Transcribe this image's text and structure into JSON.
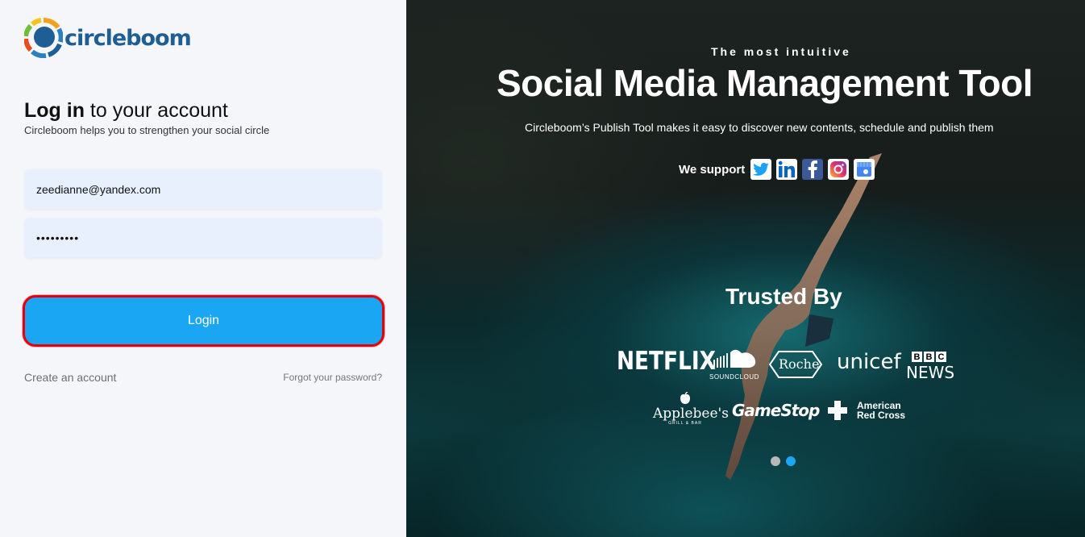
{
  "brand": {
    "name": "circleboom"
  },
  "login": {
    "title_bold": "Log in",
    "title_rest": " to your account",
    "subtitle": "Circleboom helps you to strengthen your social circle",
    "email_value": "zeedianne@yandex.com",
    "password_value": "•••••••••",
    "login_label": "Login",
    "create_account": "Create an account",
    "forgot_password": "Forgot your password?"
  },
  "hero": {
    "tagline": "The most intuitive",
    "headline": "Social Media Management Tool",
    "description": "Circleboom’s Publish Tool makes it easy to discover new contents, schedule and publish them",
    "support_label": "We support",
    "platform_icons": [
      "twitter-icon",
      "linkedin-icon",
      "facebook-icon",
      "instagram-icon",
      "google-my-business-icon"
    ],
    "trusted_by": "Trusted By",
    "brands": {
      "netflix": "NETFLIX",
      "soundcloud": "SOUNDCLOUD",
      "roche": "Roche",
      "unicef": "unicef",
      "bbc": "BBC",
      "news": "NEWS",
      "applebees": "Applebee's",
      "applebees_sub": "GRILL & BAR",
      "gamestop": "GameStop",
      "redcross_1": "American",
      "redcross_2": "Red Cross"
    },
    "carousel_active_index": 2
  },
  "colors": {
    "accent": "#1aa6f2",
    "highlight_border": "#e3000f",
    "logo_blue": "#1e5e94",
    "input_bg": "#e8f0fe"
  }
}
